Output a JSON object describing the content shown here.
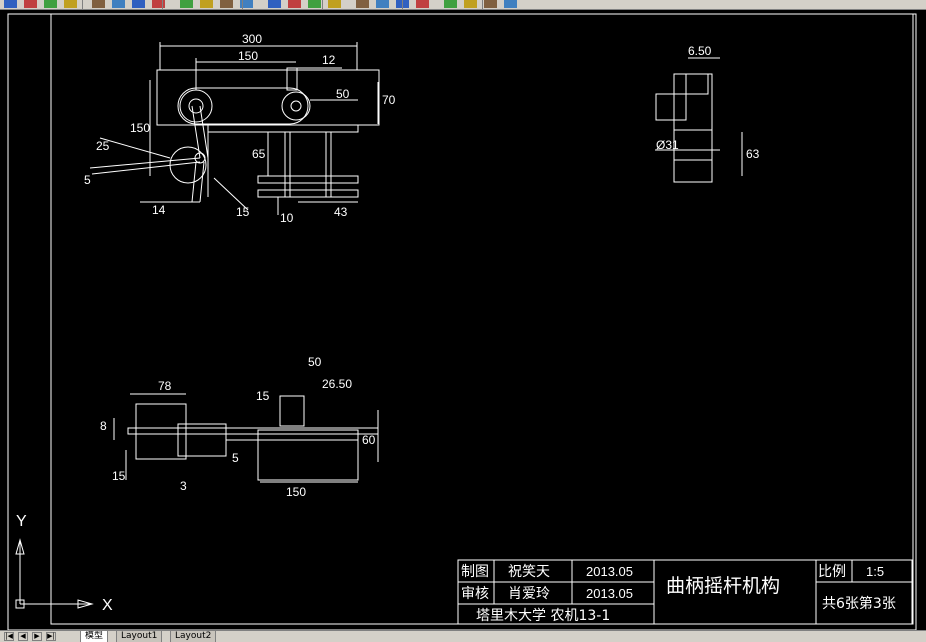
{
  "toolbar": {
    "icons": [
      "open-icon",
      "save-icon",
      "plot-icon",
      "preview-icon",
      "cut-icon",
      "copy-icon",
      "paste-icon",
      "match-icon",
      "undo-icon",
      "redo-icon",
      "pan-icon",
      "zoom-realtime-icon",
      "zoom-window-icon",
      "zoom-previous-icon",
      "properties-icon",
      "design-center-icon",
      "tool-palette-icon",
      "sheet-set-icon",
      "markup-icon",
      "calculator-icon",
      "help-icon",
      "layer-icon",
      "layer-state-icon",
      "layer-previous-icon"
    ]
  },
  "drawing": {
    "top_view": {
      "dim_300": "300",
      "dim_150": "150",
      "dim_12": "12",
      "dim_50": "50",
      "dim_70": "70",
      "dim_150v": "150",
      "dim_R25": "25",
      "dim_5": "5",
      "dim_65": "65",
      "dim_14": "14",
      "dim_15": "15",
      "dim_10": "10",
      "dim_43": "43"
    },
    "side_view": {
      "dim_6_50": "6.50",
      "dim_phi31": "Ø31",
      "dim_63": "63"
    },
    "front_view": {
      "dim_78": "78",
      "dim_8": "8",
      "dim_15a": "15",
      "dim_15b": "15",
      "dim_3": "3",
      "dim_5": "5",
      "dim_50": "50",
      "dim_26_50": "26.50",
      "dim_60": "60",
      "dim_150": "150"
    },
    "ucs": {
      "x_label": "X",
      "y_label": "Y"
    }
  },
  "title_block": {
    "drawn_label": "制图",
    "drawn_name": "祝笑天",
    "drawn_date": "2013.05",
    "check_label": "审核",
    "check_name": "肖爱玲",
    "check_date": "2013.05",
    "school": "塔里木大学  农机13-1",
    "title": "曲柄摇杆机构",
    "scale_label": "比例",
    "scale_value": "1:5",
    "sheet_info": "共6张第3张"
  },
  "tabs": [
    {
      "label": "模型",
      "active": true
    },
    {
      "label": "Layout1",
      "active": false
    },
    {
      "label": "Layout2",
      "active": false
    }
  ],
  "colors": {
    "background": "#000000",
    "lines": "#ffffff",
    "ui_gray": "#d4d0c8"
  }
}
